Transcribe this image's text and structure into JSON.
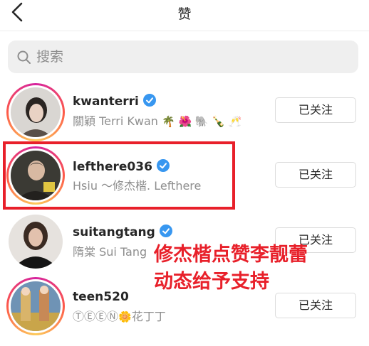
{
  "header": {
    "title": "赞"
  },
  "search": {
    "placeholder": "搜索"
  },
  "users": [
    {
      "username": "kwanterri",
      "full_name": "關穎 Terri Kwan",
      "emoji": "🌴 🌺 🐘 🍾 🥂",
      "verified": true,
      "button": "已关注"
    },
    {
      "username": "lefthere036",
      "full_name": "Hsiu ～修杰楷.   Lefthere",
      "verified": true,
      "button": "已关注"
    },
    {
      "username": "suitangtang",
      "full_name": "隋棠 Sui Tang",
      "verified": true,
      "button": "已关注"
    },
    {
      "username": "teen520",
      "full_name_prefix": "ⓉⒺⒺⓃ",
      "full_name_emoji": "🌼",
      "full_name_suffix": "花丁丁",
      "verified": false,
      "button": "已关注"
    }
  ],
  "annotation": {
    "line1": "修杰楷点赞李靓蕾",
    "line2": "动态给予支持"
  },
  "colors": {
    "accent_red": "#e8202a",
    "verified_blue": "#3897f0",
    "secondary_text": "#8e8e8e"
  }
}
